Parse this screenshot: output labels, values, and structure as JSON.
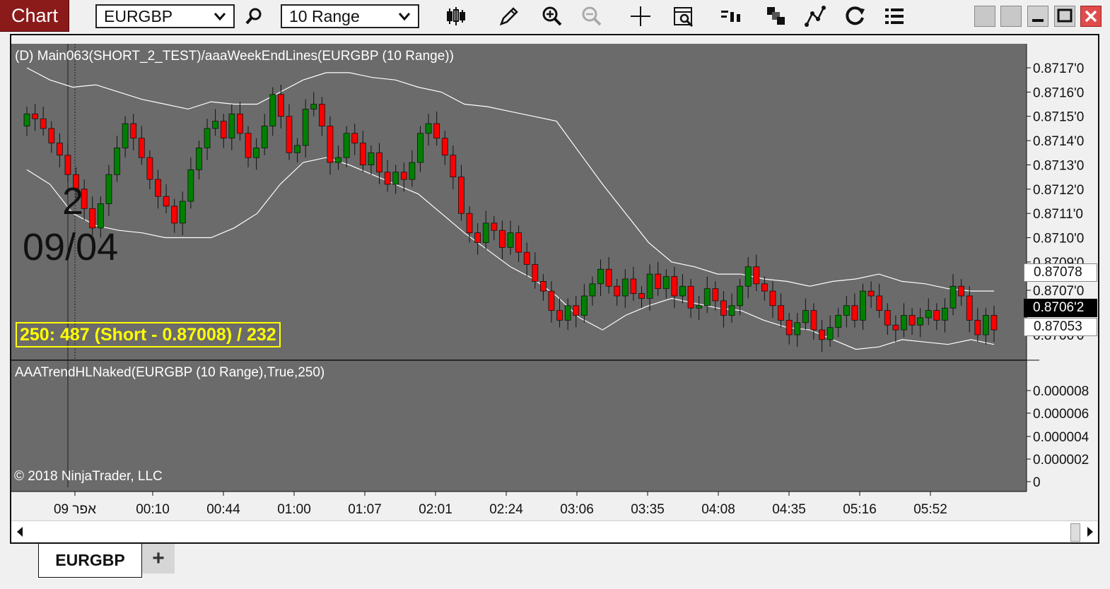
{
  "toolbar": {
    "title": "Chart",
    "instrument": "EURGBP",
    "interval": "10 Range",
    "icons": [
      "search-icon",
      "bars-icon",
      "pencil-icon",
      "zoom-in-icon",
      "zoom-out-icon",
      "crosshair-icon",
      "properties-icon",
      "data-box-icon",
      "order-tabs-icon",
      "drawing-tools-icon",
      "reload-icon",
      "list-icon"
    ]
  },
  "main_panel": {
    "title": "(D) Main063(SHORT_2_TEST)/aaaWeekEndLines(EURGBP (10 Range))",
    "stat_box": "250: 487 (Short - 0.87008) / 232",
    "marker_top": "2",
    "marker_bottom": "09/04",
    "price_ticks": [
      "0.8717'0",
      "0.8716'0",
      "0.8715'0",
      "0.8714'0",
      "0.8713'0",
      "0.8712'0",
      "0.8711'0",
      "0.8710'0",
      "0.8709'0",
      "0.8707'0",
      "0.8706'0"
    ],
    "tag_upper": "0.87078",
    "tag_last": "0.8706'2",
    "tag_lower": "0.87053"
  },
  "lower_panel": {
    "title": "AAATrendHLNaked(EURGBP (10 Range),True,250)",
    "ticks": [
      "0.000008",
      "0.000006",
      "0.000004",
      "0.000002",
      "0"
    ],
    "copyright": "© 2018 NinjaTrader, LLC"
  },
  "time_axis": [
    "אפר 09",
    "00:10",
    "00:44",
    "01:00",
    "01:07",
    "02:01",
    "02:24",
    "03:06",
    "03:35",
    "04:08",
    "04:35",
    "05:16",
    "05:52"
  ],
  "tabs": {
    "active": "EURGBP",
    "add": "+"
  },
  "colors": {
    "up": "#008000",
    "down": "#ff0000",
    "background": "#6b6b6b",
    "band": "#ffffff",
    "title_bar": "#8b1a1a"
  },
  "chart_data": {
    "type": "candlestick",
    "title": "(D) Main063(SHORT_2_TEST)/aaaWeekEndLines(EURGBP (10 Range))",
    "x_labels": [
      "אפר 09",
      "00:10",
      "00:44",
      "01:00",
      "01:07",
      "02:01",
      "02:24",
      "03:06",
      "03:35",
      "04:08",
      "04:35",
      "05:16",
      "05:52"
    ],
    "ylim": [
      0.87055,
      0.87175
    ],
    "close_series": [
      0.87151,
      0.87149,
      0.87145,
      0.87139,
      0.87134,
      0.87126,
      0.8712,
      0.87112,
      0.87104,
      0.87114,
      0.87126,
      0.87137,
      0.87147,
      0.87141,
      0.87133,
      0.87124,
      0.87117,
      0.87113,
      0.87106,
      0.87115,
      0.87128,
      0.87137,
      0.87145,
      0.87148,
      0.87141,
      0.87151,
      0.87143,
      0.87133,
      0.87137,
      0.87146,
      0.87159,
      0.8715,
      0.87135,
      0.87138,
      0.87153,
      0.87155,
      0.87146,
      0.87131,
      0.87133,
      0.87143,
      0.87139,
      0.8713,
      0.87135,
      0.87127,
      0.87122,
      0.87127,
      0.87124,
      0.87131,
      0.87143,
      0.87147,
      0.87141,
      0.87134,
      0.87125,
      0.8711,
      0.87102,
      0.87098,
      0.87106,
      0.87103,
      0.87096,
      0.87102,
      0.87094,
      0.87089,
      0.87082,
      0.87078,
      0.8707,
      0.87066,
      0.87072,
      0.87068,
      0.87076,
      0.87081,
      0.87087,
      0.8708,
      0.87076,
      0.87083,
      0.87077,
      0.87075,
      0.87085,
      0.87079,
      0.87084,
      0.87076,
      0.8708,
      0.87071,
      0.87072,
      0.87079,
      0.87074,
      0.87068,
      0.87072,
      0.8708,
      0.87088,
      0.87081,
      0.87078,
      0.87072,
      0.87066,
      0.8706,
      0.87065,
      0.8707,
      0.87062,
      0.87058,
      0.87063,
      0.87068,
      0.87072,
      0.87066,
      0.87078,
      0.87076,
      0.8707,
      0.87064,
      0.87062,
      0.87068,
      0.87064,
      0.87067,
      0.8707,
      0.87066,
      0.87071,
      0.8708,
      0.87076,
      0.87066,
      0.8706,
      0.87068,
      0.87062
    ],
    "band_upper": [
      0.8717,
      0.87165,
      0.87162,
      0.87163,
      0.8716,
      0.87157,
      0.87155,
      0.87153,
      0.87156,
      0.87155,
      0.87155,
      0.8716,
      0.87165,
      0.87168,
      0.87168,
      0.87166,
      0.87165,
      0.87162,
      0.8716,
      0.87155,
      0.87154,
      0.87152,
      0.8715,
      0.87148,
      0.87135,
      0.87122,
      0.8711,
      0.87098,
      0.8709,
      0.87088,
      0.87085,
      0.87085,
      0.87083,
      0.87082,
      0.8708,
      0.87082,
      0.87083,
      0.87085,
      0.87082,
      0.87081,
      0.87079,
      0.87078,
      0.87078
    ],
    "band_lower": [
      0.87128,
      0.87122,
      0.8711,
      0.87105,
      0.87103,
      0.87102,
      0.871,
      0.871,
      0.871,
      0.87104,
      0.8711,
      0.87122,
      0.87131,
      0.87133,
      0.8713,
      0.87126,
      0.87122,
      0.87118,
      0.8711,
      0.87102,
      0.87095,
      0.87088,
      0.87083,
      0.87076,
      0.87067,
      0.87062,
      0.87068,
      0.87072,
      0.87075,
      0.87073,
      0.87071,
      0.8707,
      0.87066,
      0.87063,
      0.87062,
      0.87058,
      0.87054,
      0.87055,
      0.87058,
      0.87057,
      0.87056,
      0.87058,
      0.87056
    ],
    "indicator_value": 0,
    "grid": false
  }
}
